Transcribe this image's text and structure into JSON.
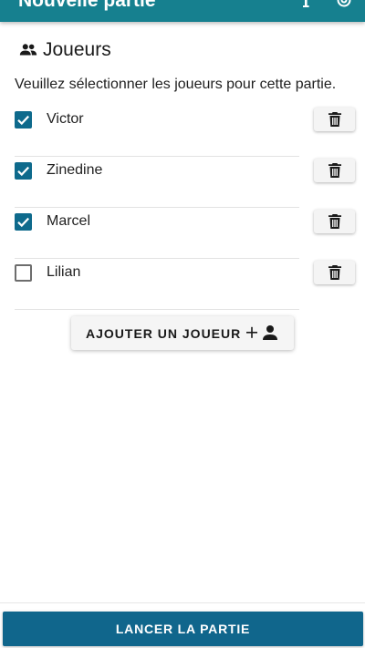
{
  "app_bar": {
    "title": "Nouvelle partie",
    "actions": [
      {
        "icon": "info-icon"
      },
      {
        "icon": "gear-icon"
      }
    ],
    "color": "#16808f"
  },
  "players_section": {
    "icon": "group-icon",
    "title": "Joueurs",
    "instruction": "Veuillez sélectionner les joueurs pour cette partie."
  },
  "players": [
    {
      "name": "Victor",
      "selected": true
    },
    {
      "name": "Zinedine",
      "selected": true
    },
    {
      "name": "Marcel",
      "selected": true
    },
    {
      "name": "Lilian",
      "selected": false
    }
  ],
  "add_player": {
    "label": "AJOUTER UN JOUEUR",
    "icon": "add-person-icon"
  },
  "launch": {
    "label": "LANCER LA PARTIE",
    "color": "#10668c"
  }
}
